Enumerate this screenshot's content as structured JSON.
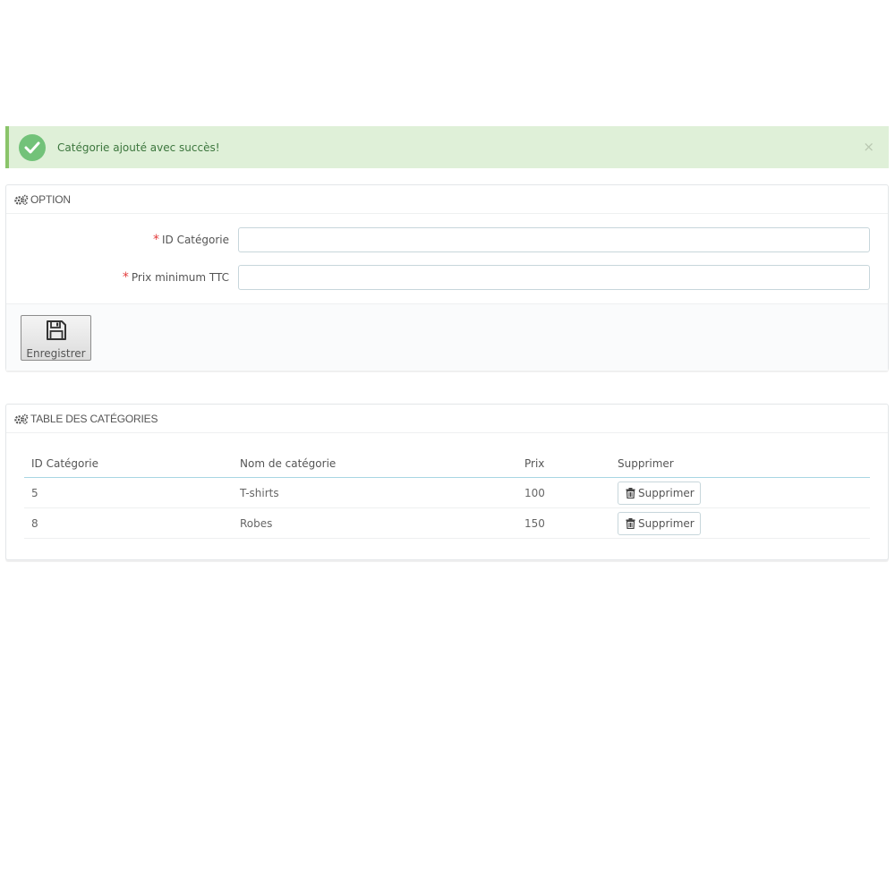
{
  "alert": {
    "message": "Catégorie ajouté avec succès!",
    "close_label": "×",
    "icon": "check-circle-icon",
    "color": "#72c279"
  },
  "option_panel": {
    "title": "OPTION",
    "icon": "cogs-icon",
    "fields": [
      {
        "label": "ID Catégorie",
        "required_mark": "*",
        "value": ""
      },
      {
        "label": "Prix minimum TTC",
        "required_mark": "*",
        "value": ""
      }
    ],
    "save_button": {
      "label": "Enregistrer",
      "icon": "floppy-disk-icon"
    }
  },
  "table_panel": {
    "title": "TABLE DES CATÉGORIES",
    "icon": "cogs-icon",
    "columns": [
      "ID Catégorie",
      "Nom de catégorie",
      "Prix",
      "Supprimer"
    ],
    "rows": [
      {
        "id": "5",
        "name": "T-shirts",
        "price": "100",
        "action": "Supprimer"
      },
      {
        "id": "8",
        "name": "Robes",
        "price": "150",
        "action": "Supprimer"
      }
    ],
    "delete_icon": "trash-icon"
  },
  "colors": {
    "alert_bg": "#dff0d8",
    "alert_text": "#3c763d",
    "required": "#e33c3c",
    "table_header_border": "#a8d6e3"
  }
}
